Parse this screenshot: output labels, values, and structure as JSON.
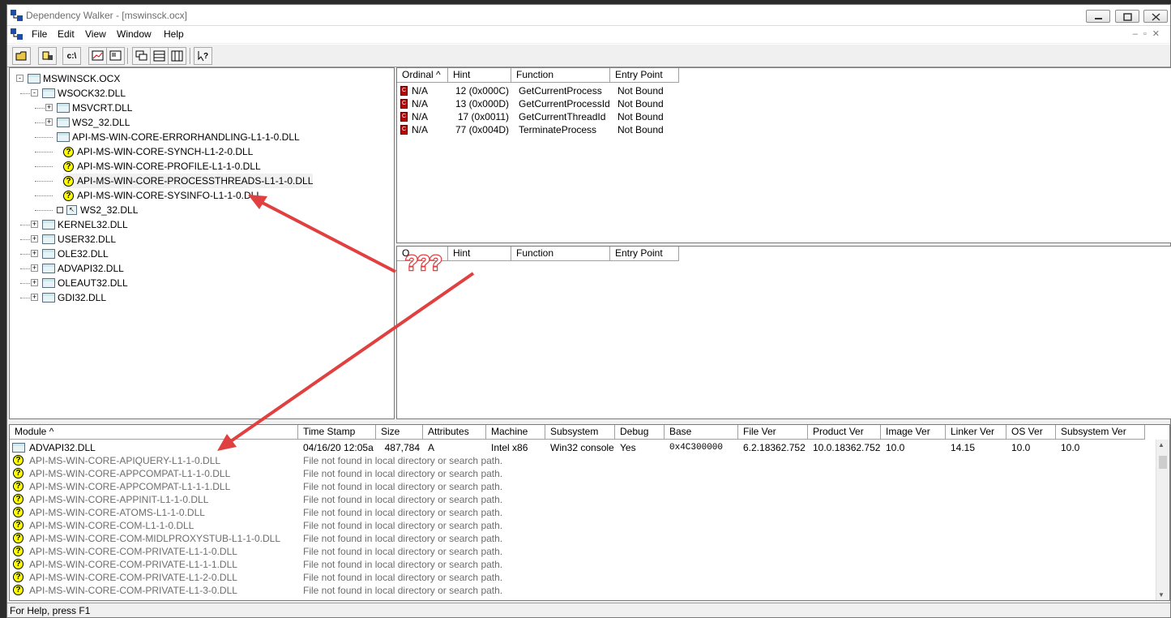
{
  "window": {
    "title": "Dependency Walker - [mswinsck.ocx]"
  },
  "menu": [
    "File",
    "Edit",
    "View",
    "Window",
    "Help"
  ],
  "toolbar": {
    "buttons": [
      "open",
      "find",
      "c:\\",
      "profile",
      "properties",
      "tile",
      "cascade",
      "split",
      "help"
    ],
    "cdir_label": "c:\\"
  },
  "tree": [
    {
      "label": "MSWINSCK.OCX",
      "level": 0,
      "icon": "module",
      "exp": "-"
    },
    {
      "label": "WSOCK32.DLL",
      "level": 1,
      "icon": "module",
      "exp": "-"
    },
    {
      "label": "MSVCRT.DLL",
      "level": 2,
      "icon": "module",
      "exp": "+"
    },
    {
      "label": "WS2_32.DLL",
      "level": 2,
      "icon": "module",
      "exp": "+"
    },
    {
      "label": "API-MS-WIN-CORE-ERRORHANDLING-L1-1-0.DLL",
      "level": 2,
      "icon": "module",
      "exp": ""
    },
    {
      "label": "API-MS-WIN-CORE-SYNCH-L1-2-0.DLL",
      "level": 2,
      "icon": "missing",
      "exp": ""
    },
    {
      "label": "API-MS-WIN-CORE-PROFILE-L1-1-0.DLL",
      "level": 2,
      "icon": "missing",
      "exp": ""
    },
    {
      "label": "API-MS-WIN-CORE-PROCESSTHREADS-L1-1-0.DLL",
      "level": 2,
      "icon": "missing",
      "exp": "",
      "highlight": true
    },
    {
      "label": "API-MS-WIN-CORE-SYSINFO-L1-1-0.DLL",
      "level": 2,
      "icon": "missing",
      "exp": ""
    },
    {
      "label": "WS2_32.DLL",
      "level": 2,
      "icon": "forward",
      "exp": ""
    },
    {
      "label": "KERNEL32.DLL",
      "level": 1,
      "icon": "module",
      "exp": "+"
    },
    {
      "label": "USER32.DLL",
      "level": 1,
      "icon": "module",
      "exp": "+"
    },
    {
      "label": "OLE32.DLL",
      "level": 1,
      "icon": "module",
      "exp": "+"
    },
    {
      "label": "ADVAPI32.DLL",
      "level": 1,
      "icon": "module",
      "exp": "+"
    },
    {
      "label": "OLEAUT32.DLL",
      "level": 1,
      "icon": "module",
      "exp": "+"
    },
    {
      "label": "GDI32.DLL",
      "level": 1,
      "icon": "module",
      "exp": "+"
    }
  ],
  "imports": {
    "headers": [
      "Ordinal ^",
      "Hint",
      "Function",
      "Entry Point"
    ],
    "rows": [
      [
        "N/A",
        "12  (0x000C)",
        "GetCurrentProcess",
        "Not Bound"
      ],
      [
        "N/A",
        "13  (0x000D)",
        "GetCurrentProcessId",
        "Not Bound"
      ],
      [
        "N/A",
        "17  (0x0011)",
        "GetCurrentThreadId",
        "Not Bound"
      ],
      [
        "N/A",
        "77  (0x004D)",
        "TerminateProcess",
        "Not Bound"
      ]
    ]
  },
  "exports": {
    "headers": [
      "O",
      "Hint",
      "Function",
      "Entry Point"
    ]
  },
  "annotation": {
    "text": "???",
    "color": "#e04040"
  },
  "modules": {
    "headers": [
      "Module ^",
      "Time Stamp",
      "Size",
      "Attributes",
      "Machine",
      "Subsystem",
      "Debug",
      "Base",
      "File Ver",
      "Product Ver",
      "Image Ver",
      "Linker Ver",
      "OS Ver",
      "Subsystem Ver"
    ],
    "first_row": [
      "ADVAPI32.DLL",
      "04/16/20  12:05a",
      "487,784",
      "A",
      "Intel x86",
      "Win32 console",
      "Yes",
      "0x4C300000",
      "6.2.18362.752",
      "10.0.18362.752",
      "10.0",
      "14.15",
      "10.0",
      "10.0"
    ],
    "missing_text": "File not found in local directory or search path.",
    "missing": [
      "API-MS-WIN-CORE-APIQUERY-L1-1-0.DLL",
      "API-MS-WIN-CORE-APPCOMPAT-L1-1-0.DLL",
      "API-MS-WIN-CORE-APPCOMPAT-L1-1-1.DLL",
      "API-MS-WIN-CORE-APPINIT-L1-1-0.DLL",
      "API-MS-WIN-CORE-ATOMS-L1-1-0.DLL",
      "API-MS-WIN-CORE-COM-L1-1-0.DLL",
      "API-MS-WIN-CORE-COM-MIDLPROXYSTUB-L1-1-0.DLL",
      "API-MS-WIN-CORE-COM-PRIVATE-L1-1-0.DLL",
      "API-MS-WIN-CORE-COM-PRIVATE-L1-1-1.DLL",
      "API-MS-WIN-CORE-COM-PRIVATE-L1-2-0.DLL",
      "API-MS-WIN-CORE-COM-PRIVATE-L1-3-0.DLL"
    ]
  },
  "status": "For Help, press F1"
}
